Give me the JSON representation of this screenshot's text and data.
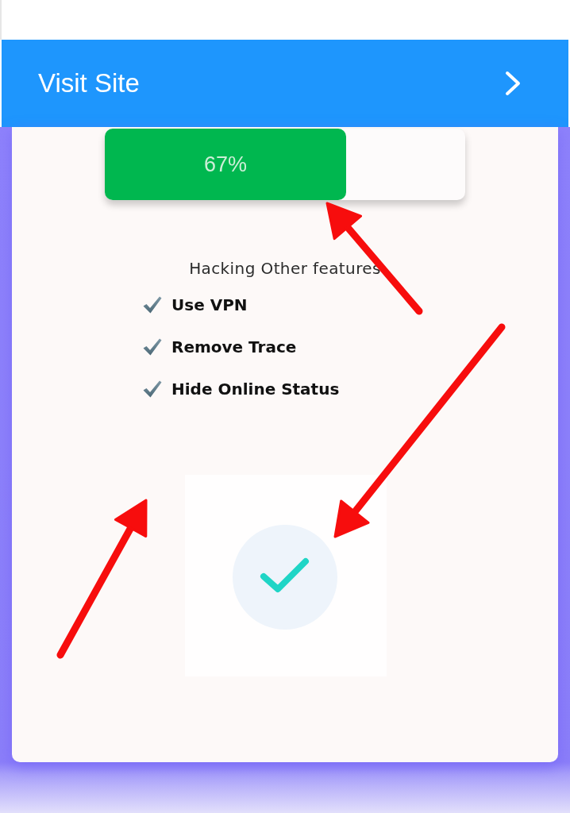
{
  "header": {
    "title": "Visit Site"
  },
  "progress": {
    "level": 0.67,
    "label": "67%"
  },
  "features": {
    "heading": "Hacking Other features",
    "items": [
      {
        "label": "Use VPN"
      },
      {
        "label": "Remove Trace"
      },
      {
        "label": "Hide Online Status"
      }
    ]
  }
}
